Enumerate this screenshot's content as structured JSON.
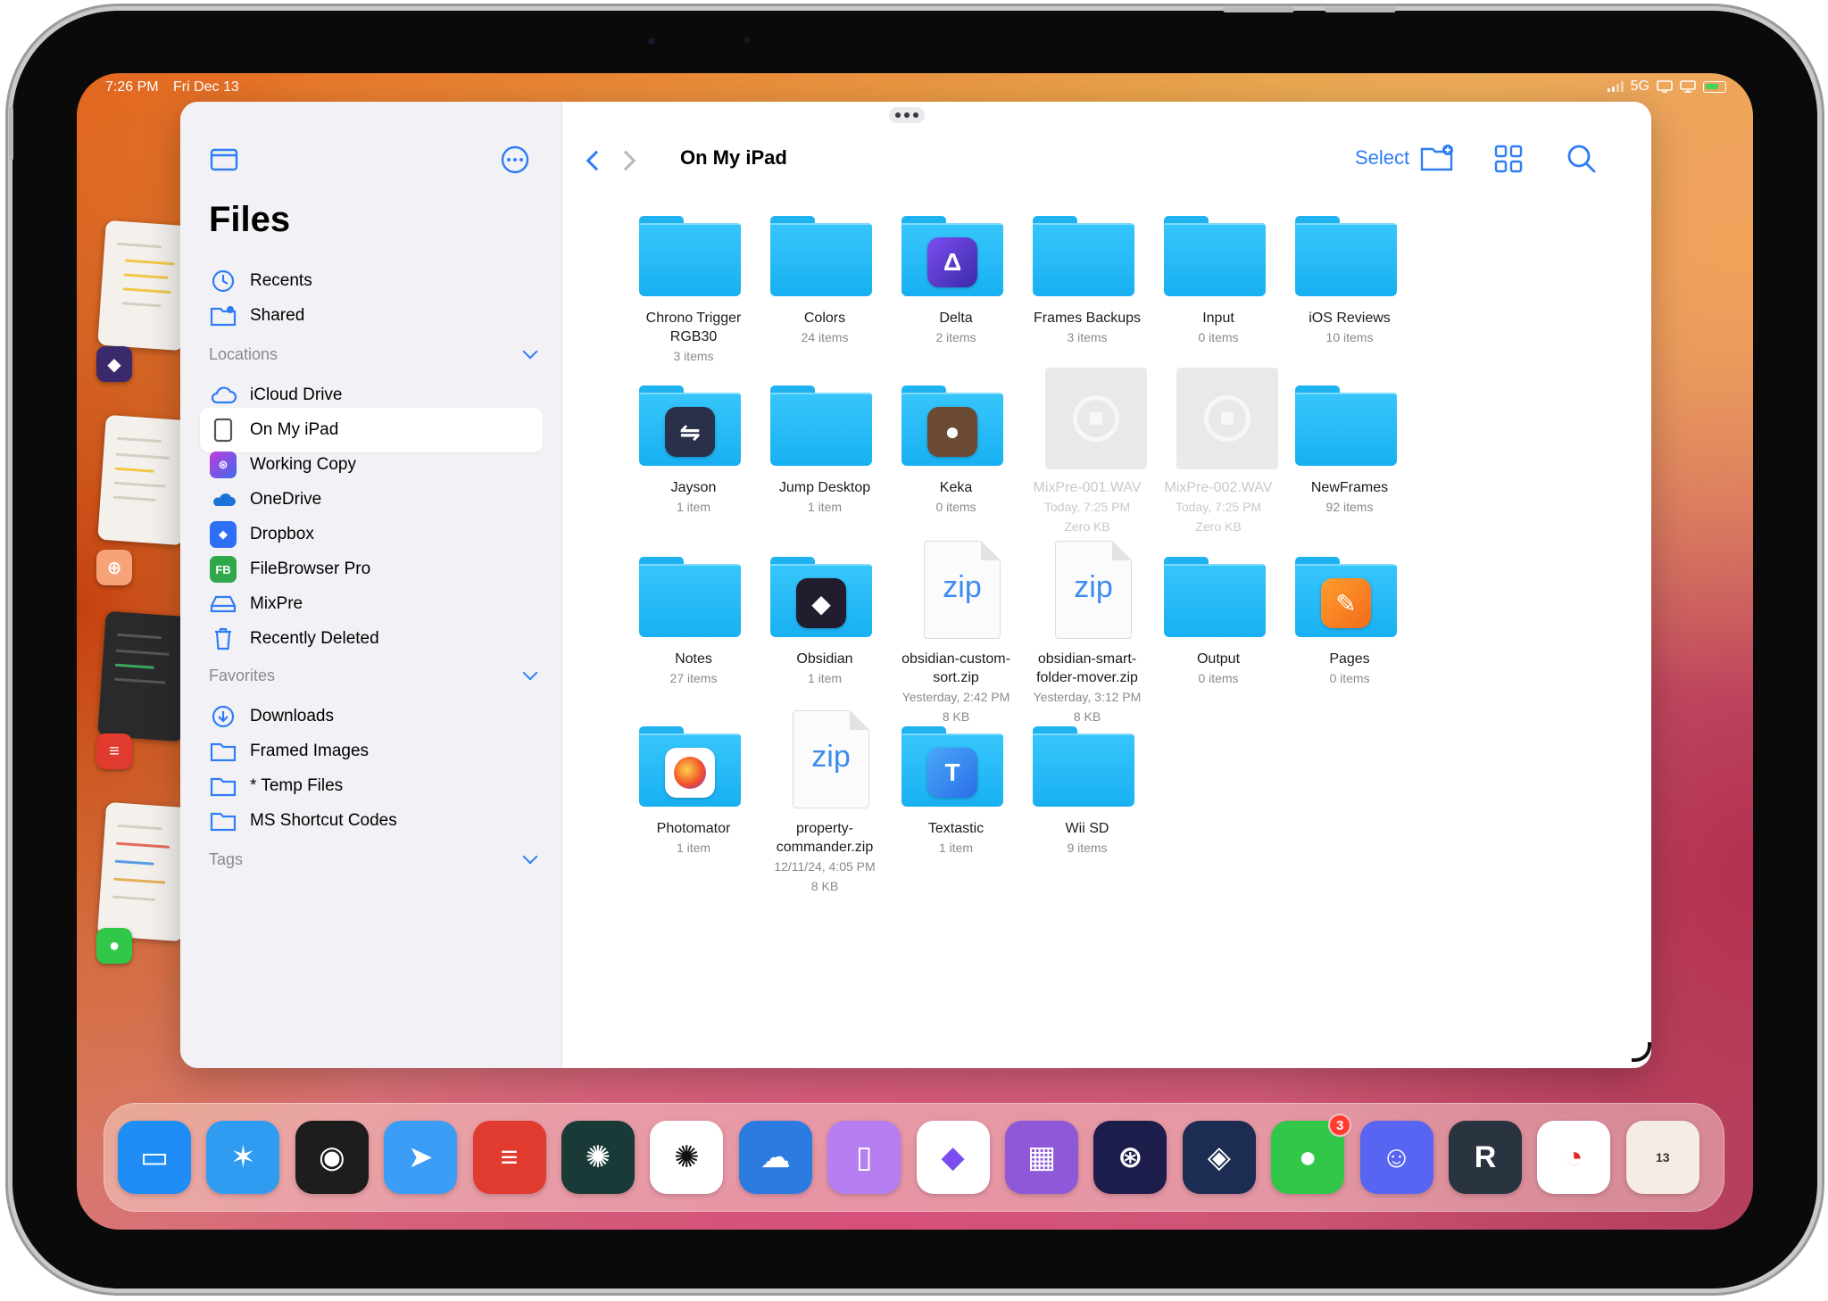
{
  "status_bar": {
    "time": "7:26 PM",
    "date": "Fri Dec 13",
    "network": "5G"
  },
  "sidebar": {
    "title": "Files",
    "top_items": [
      {
        "label": "Recents",
        "icon": "clock-icon"
      },
      {
        "label": "Shared",
        "icon": "shared-folder-icon"
      }
    ],
    "locations_header": "Locations",
    "locations": [
      {
        "label": "iCloud Drive",
        "icon": "cloud-icon"
      },
      {
        "label": "On My iPad",
        "icon": "ipad-icon",
        "selected": true
      },
      {
        "label": "Working Copy",
        "icon": "working-copy-icon"
      },
      {
        "label": "OneDrive",
        "icon": "onedrive-icon"
      },
      {
        "label": "Dropbox",
        "icon": "dropbox-icon"
      },
      {
        "label": "FileBrowser Pro",
        "icon": "filebrowser-icon",
        "badge_text": "FB"
      },
      {
        "label": "MixPre",
        "icon": "drive-icon"
      },
      {
        "label": "Recently Deleted",
        "icon": "trash-icon"
      }
    ],
    "favorites_header": "Favorites",
    "favorites": [
      {
        "label": "Downloads",
        "icon": "download-icon"
      },
      {
        "label": "Framed Images",
        "icon": "folder-icon"
      },
      {
        "label": "* Temp Files",
        "icon": "folder-icon"
      },
      {
        "label": "MS Shortcut Codes",
        "icon": "folder-icon"
      }
    ],
    "tags_header": "Tags"
  },
  "toolbar": {
    "location_title": "On My iPad",
    "select_label": "Select"
  },
  "items": [
    {
      "name": "Chrono Trigger\nRGB30",
      "line1": "3 items",
      "kind": "folder"
    },
    {
      "name": "Colors",
      "line1": "24 items",
      "kind": "folder"
    },
    {
      "name": "Delta",
      "line1": "2 items",
      "kind": "folder",
      "app": "delta"
    },
    {
      "name": "Frames Backups",
      "line1": "3 items",
      "kind": "folder"
    },
    {
      "name": "Input",
      "line1": "0 items",
      "kind": "folder"
    },
    {
      "name": "iOS Reviews",
      "line1": "10 items",
      "kind": "folder"
    },
    {
      "name": "Jayson",
      "line1": "1 item",
      "kind": "folder",
      "app": "jayson"
    },
    {
      "name": "Jump Desktop",
      "line1": "1 item",
      "kind": "folder"
    },
    {
      "name": "Keka",
      "line1": "0 items",
      "kind": "folder",
      "app": "keka"
    },
    {
      "name": "MixPre-001.WAV",
      "line1": "Today, 7:25 PM",
      "line2": "Zero KB",
      "kind": "wav"
    },
    {
      "name": "MixPre-002.WAV",
      "line1": "Today, 7:25 PM",
      "line2": "Zero KB",
      "kind": "wav"
    },
    {
      "name": "NewFrames",
      "line1": "92 items",
      "kind": "folder"
    },
    {
      "name": "Notes",
      "line1": "27 items",
      "kind": "folder"
    },
    {
      "name": "Obsidian",
      "line1": "1 item",
      "kind": "folder",
      "app": "obsidian"
    },
    {
      "name": "obsidian-custom-\nsort.zip",
      "line1": "Yesterday, 2:42 PM",
      "line2": "8 KB",
      "kind": "zip"
    },
    {
      "name": "obsidian-smart-\nfolder-mover.zip",
      "line1": "Yesterday, 3:12 PM",
      "line2": "8 KB",
      "kind": "zip"
    },
    {
      "name": "Output",
      "line1": "0 items",
      "kind": "folder"
    },
    {
      "name": "Pages",
      "line1": "0 items",
      "kind": "folder",
      "app": "pages"
    },
    {
      "name": "Photomator",
      "line1": "1 item",
      "kind": "folder",
      "app": "photomator"
    },
    {
      "name": "property-\ncommander.zip",
      "line1": "12/11/24, 4:05 PM",
      "line2": "8 KB",
      "kind": "zip"
    },
    {
      "name": "Textastic",
      "line1": "1 item",
      "kind": "folder",
      "app": "textastic"
    },
    {
      "name": "Wii SD",
      "line1": "9 items",
      "kind": "folder"
    }
  ],
  "zip_label": "zip",
  "dock": [
    {
      "name": "files",
      "color": "#1f8df5"
    },
    {
      "name": "safari",
      "color": "#2f9cf2"
    },
    {
      "name": "spotify",
      "color": "#1d1d1d"
    },
    {
      "name": "spark",
      "color": "#3b9df5"
    },
    {
      "name": "todoist",
      "color": "#e13a2e"
    },
    {
      "name": "chatgpt-dark",
      "color": "#1a3a38"
    },
    {
      "name": "chatgpt",
      "color": "#ffffff"
    },
    {
      "name": "cloud-app",
      "color": "#2b7be0"
    },
    {
      "name": "device-app",
      "color": "#b77ef2"
    },
    {
      "name": "obsidian",
      "color": "#ffffff"
    },
    {
      "name": "calculator-app",
      "color": "#8e58d8"
    },
    {
      "name": "working-copy",
      "color": "#1d1d4c"
    },
    {
      "name": "shortcuts",
      "color": "#1d2c52"
    },
    {
      "name": "messages",
      "color": "#31c84a",
      "badge": "3"
    },
    {
      "name": "discord",
      "color": "#5865f2"
    },
    {
      "name": "reeder",
      "color": "#2a3340"
    },
    {
      "name": "rss-app",
      "color": "#ffffff"
    },
    {
      "name": "app-library",
      "color": "#f6ece6",
      "label": "13"
    }
  ]
}
